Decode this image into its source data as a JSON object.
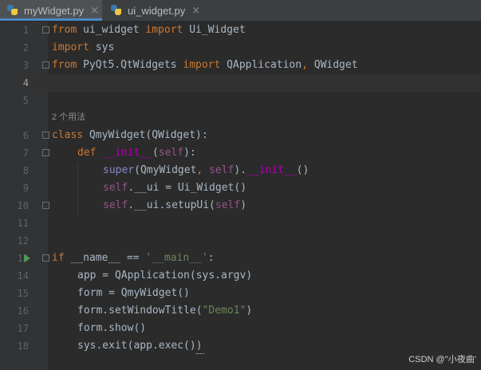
{
  "tabs": [
    {
      "label": "myWidget.py",
      "active": true,
      "close": "×"
    },
    {
      "label": "ui_widget.py",
      "active": false,
      "close": "×"
    }
  ],
  "hint_usages": "2 个用法",
  "lines": [
    {
      "n": "1"
    },
    {
      "n": "2"
    },
    {
      "n": "3"
    },
    {
      "n": "4"
    },
    {
      "n": "5"
    },
    {
      "n": "6"
    },
    {
      "n": "7"
    },
    {
      "n": "8"
    },
    {
      "n": "9"
    },
    {
      "n": "10"
    },
    {
      "n": "11"
    },
    {
      "n": "12"
    },
    {
      "n": "13"
    },
    {
      "n": "14"
    },
    {
      "n": "15"
    },
    {
      "n": "16"
    },
    {
      "n": "17"
    },
    {
      "n": "18"
    }
  ],
  "code": {
    "l1": [
      "from",
      " ui_widget ",
      "import",
      " Ui_Widget"
    ],
    "l2": [
      "import",
      " sys"
    ],
    "l3": [
      "from",
      " PyQt5.QtWidgets ",
      "import",
      " QApplication",
      ",",
      " QWidget"
    ],
    "l6": [
      "class",
      " QmyWidget(QWidget):"
    ],
    "l7": [
      "def",
      " ",
      "__init__",
      "(",
      "self",
      "):"
    ],
    "l8": [
      "super",
      "(QmyWidget",
      ",",
      " ",
      "self",
      ").",
      "__init__",
      "()"
    ],
    "l9": [
      "self",
      ".__ui = Ui_Widget()"
    ],
    "l10": [
      "self",
      ".__ui.setupUi(",
      "self",
      ")"
    ],
    "l13": [
      "if",
      " __name__ == ",
      "'__main__'",
      ":"
    ],
    "l14": "app = QApplication(sys.argv)",
    "l15": "form = QmyWidget()",
    "l16": [
      "form.setWindowTitle(",
      "\"Demo1\"",
      ")"
    ],
    "l17": "form.show()",
    "l18": "sys.exit(app.exec())"
  },
  "watermark": "CSDN @''小夜曲'",
  "colors": {
    "keyword": "#cc7832",
    "string": "#6a8759",
    "self": "#94558d",
    "magic": "#b200b2",
    "text": "#a9b7c6"
  }
}
